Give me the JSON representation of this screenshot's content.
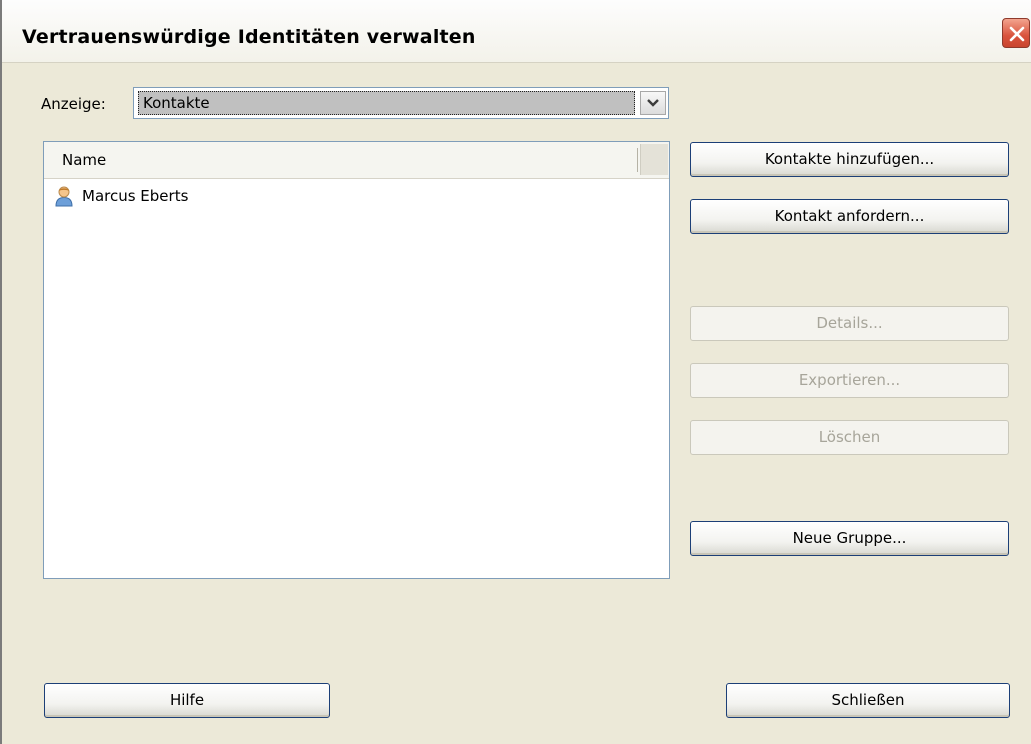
{
  "window": {
    "title": "Vertrauenswürdige Identitäten verwalten",
    "close_icon": "close-icon"
  },
  "view": {
    "label": "Anzeige:",
    "selected": "Kontakte"
  },
  "list": {
    "columns": [
      "Name"
    ],
    "rows": [
      {
        "name": "Marcus Eberts",
        "icon": "contact-person-icon"
      }
    ]
  },
  "actions": {
    "add_contacts": "Kontakte hinzufügen...",
    "request_contact": "Kontakt anfordern...",
    "details": "Details...",
    "export": "Exportieren...",
    "delete": "Löschen",
    "new_group": "Neue Gruppe..."
  },
  "footer": {
    "help": "Hilfe",
    "close": "Schließen"
  },
  "colors": {
    "dialog_bg": "#ece9d8",
    "button_border": "#1c3f77",
    "disabled_text": "#a7a59a",
    "close_button": "#d9533d"
  }
}
